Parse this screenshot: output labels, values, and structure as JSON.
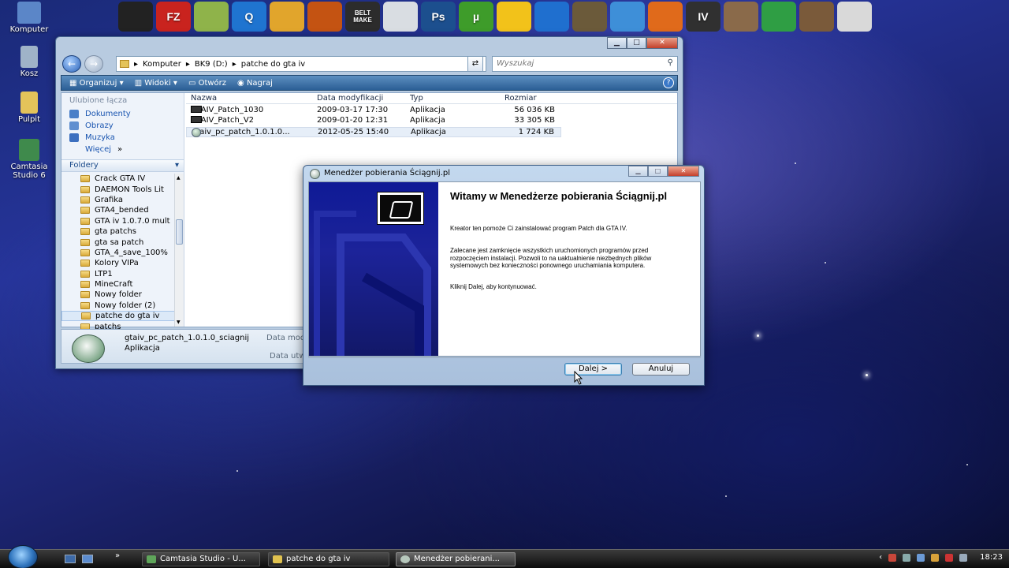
{
  "desktop": {
    "icons": [
      {
        "label": "Komputer",
        "color": "#5b86c8"
      },
      {
        "label": "Kosz",
        "color": "#9fb3c8"
      },
      {
        "label": "Pulpit",
        "color": "#e4c35a"
      },
      {
        "label": "Camtasia Studio 6",
        "color": "#3f8a4c"
      }
    ]
  },
  "dock": {
    "items": [
      {
        "label": "",
        "color": "#222222",
        "icon": "soldier-icon"
      },
      {
        "label": "FZ",
        "color": "#c9231e",
        "icon": "filezilla-icon"
      },
      {
        "label": "",
        "color": "#8fb34a",
        "icon": "folder-green-icon"
      },
      {
        "label": "Q",
        "color": "#1f74d0",
        "icon": "quicktime-icon"
      },
      {
        "label": "",
        "color": "#e1a52c",
        "icon": "toucan-icon"
      },
      {
        "label": "",
        "color": "#c45312",
        "icon": "sun-icon"
      },
      {
        "label": "BELT MAKE",
        "color": "#2c2c2c",
        "icon": "beltmake-icon"
      },
      {
        "label": "",
        "color": "#d9dde2",
        "icon": "camera-icon"
      },
      {
        "label": "Ps",
        "color": "#1c4f8e",
        "icon": "photoshop-icon"
      },
      {
        "label": "µ",
        "color": "#3e9c2a",
        "icon": "utorrent-icon"
      },
      {
        "label": "",
        "color": "#f2c21a",
        "icon": "smiley-icon"
      },
      {
        "label": "",
        "color": "#1f6fcf",
        "icon": "lightning-icon"
      },
      {
        "label": "",
        "color": "#6b5a3a",
        "icon": "gimp-icon"
      },
      {
        "label": "",
        "color": "#3e8fd8",
        "icon": "safari-icon"
      },
      {
        "label": "",
        "color": "#e06a1b",
        "icon": "firefox-icon"
      },
      {
        "label": "IV",
        "color": "#303030",
        "icon": "gta-iv-icon"
      },
      {
        "label": "",
        "color": "#8a6a4a",
        "icon": "man-icon"
      },
      {
        "label": "",
        "color": "#2f9e44",
        "icon": "chrome-icon"
      },
      {
        "label": "",
        "color": "#7a5a3a",
        "icon": "cj-icon"
      },
      {
        "label": "",
        "color": "#d9d9d9",
        "icon": "wrench-icon"
      }
    ]
  },
  "explorer": {
    "breadcrumb": [
      "Komputer",
      "BK9 (D:)",
      "patche do gta iv"
    ],
    "search_placeholder": "Wyszukaj",
    "toolbar": {
      "organize": "Organizuj",
      "views": "Widoki",
      "open": "Otwórz",
      "burn": "Nagraj"
    },
    "favorites_header": "Ulubione łącza",
    "favorites": [
      {
        "label": "Dokumenty",
        "color": "#4a7fc8"
      },
      {
        "label": "Obrazy",
        "color": "#5f8fd0"
      },
      {
        "label": "Muzyka",
        "color": "#3c6fbf"
      },
      {
        "label": "Więcej",
        "color": "#ffffff"
      }
    ],
    "more_arrows": "»",
    "folders_header": "Foldery",
    "folders": [
      "Crack GTA IV",
      "DAEMON Tools Lit",
      "Grafika",
      "GTA4_bended",
      "GTA iv 1.0.7.0 mult",
      "gta patchs",
      "gta sa patch",
      "GTA_4_save_100%",
      "Kolory VIPa",
      "LTP1",
      "MineCraft",
      "Nowy folder",
      "Nowy folder (2)",
      "patche do gta iv",
      "patchs"
    ],
    "selected_folder": "patche do gta iv",
    "columns": {
      "name": "Nazwa",
      "modified": "Data modyfikacji",
      "type": "Typ",
      "size": "Rozmiar"
    },
    "files": [
      {
        "name": "GTAIV_Patch_1030",
        "modified": "2009-03-17 17:30",
        "type": "Aplikacja",
        "size": "56 036 KB",
        "icon": "gta-file-icon"
      },
      {
        "name": "GTAIV_Patch_V2",
        "modified": "2009-01-20 12:31",
        "type": "Aplikacja",
        "size": "33 305 KB",
        "icon": "gta-file-icon"
      },
      {
        "name": "gtaiv_pc_patch_1.0.1.0...",
        "modified": "2012-05-25 15:40",
        "type": "Aplikacja",
        "size": "1 724 KB",
        "icon": "setup-file-icon"
      }
    ],
    "details": {
      "name": "gtaiv_pc_patch_1.0.1.0_sciagnij",
      "type": "Aplikacja",
      "key1": "Data mod",
      "key2": "Data utw"
    }
  },
  "dialog": {
    "title": "Menedżer pobierania Ściągnij.pl",
    "heading": "Witamy w Menedżerze pobierania Ściągnij.pl",
    "p1": "Kreator ten pomoże Ci zainstalować program Patch dla GTA IV.",
    "p2": "Zalecane jest zamknięcie wszystkich uruchomionych programów przed rozpoczęciem instalacji. Pozwoli to na uaktualnienie niezbędnych plików systemowych bez konieczności ponownego uruchamiania komputera.",
    "p3": "Kliknij Dalej, aby kontynuować.",
    "next_button": "Dalej >",
    "cancel_button": "Anuluj"
  },
  "taskbar": {
    "tasks": [
      {
        "label": "Camtasia Studio - U...",
        "color": "#5fa55a"
      },
      {
        "label": "patche do gta iv",
        "color": "#e0c24f"
      },
      {
        "label": "Menedżer pobierani...",
        "color": "#b6c7bc"
      }
    ],
    "clock": "18:23"
  }
}
